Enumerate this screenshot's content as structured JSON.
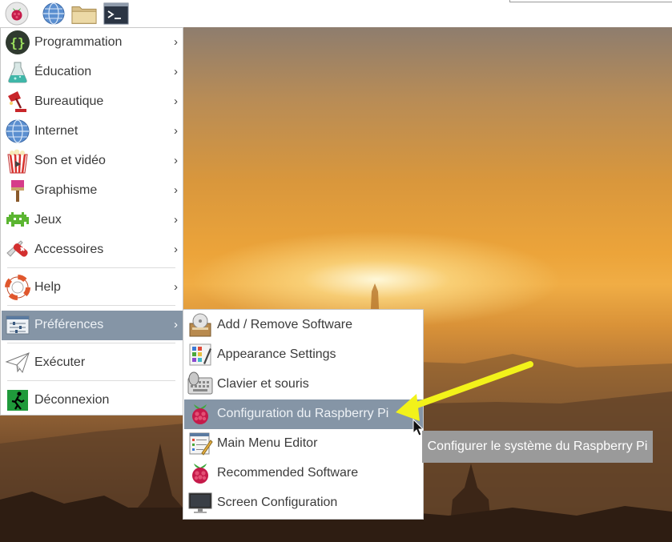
{
  "panel": {
    "icons": [
      "raspberry-menu-icon",
      "web-browser-icon",
      "file-manager-icon",
      "terminal-icon"
    ]
  },
  "main_menu": {
    "items": [
      {
        "label": "Programmation",
        "icon": "braces-icon"
      },
      {
        "label": "Éducation",
        "icon": "flask-icon"
      },
      {
        "label": "Bureautique",
        "icon": "desk-lamp-icon"
      },
      {
        "label": "Internet",
        "icon": "globe-icon"
      },
      {
        "label": "Son et vidéo",
        "icon": "popcorn-icon"
      },
      {
        "label": "Graphisme",
        "icon": "paintbrush-icon"
      },
      {
        "label": "Jeux",
        "icon": "space-invader-icon"
      },
      {
        "label": "Accessoires",
        "icon": "pocket-knife-icon"
      },
      {
        "label": "Help",
        "icon": "lifebuoy-icon"
      },
      {
        "label": "Préférences",
        "icon": "preferences-sliders-icon"
      },
      {
        "label": "Exécuter",
        "icon": "paper-plane-icon"
      },
      {
        "label": "Déconnexion",
        "icon": "exit-icon"
      }
    ],
    "submenu_arrow": "›"
  },
  "preferences_submenu": {
    "items": [
      {
        "label": "Add / Remove Software",
        "icon": "software-package-icon"
      },
      {
        "label": "Appearance Settings",
        "icon": "appearance-palette-icon"
      },
      {
        "label": "Clavier et souris",
        "icon": "keyboard-mouse-icon"
      },
      {
        "label": "Configuration du Raspberry Pi",
        "icon": "raspberry-icon"
      },
      {
        "label": "Main Menu Editor",
        "icon": "menu-editor-icon"
      },
      {
        "label": "Recommended Software",
        "icon": "raspberry-icon"
      },
      {
        "label": "Screen Configuration",
        "icon": "monitor-icon"
      }
    ],
    "selected_index": 3
  },
  "tooltip": {
    "text": "Configurer le système du Raspberry Pi"
  },
  "colors": {
    "menu_highlight": "#8595a6",
    "tooltip_bg": "#9a9a9a",
    "annotation_arrow": "#f2f21a"
  }
}
